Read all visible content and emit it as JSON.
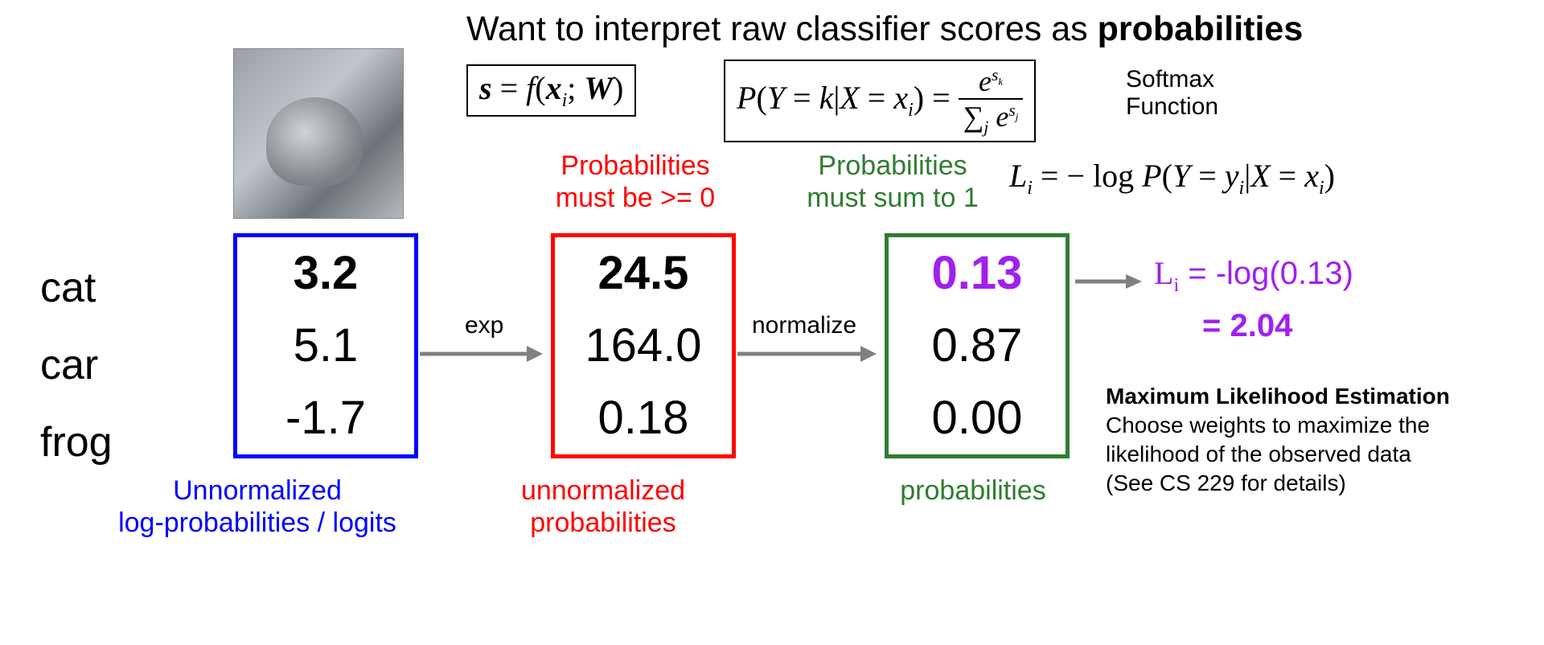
{
  "title": {
    "prefix": "Want to interpret raw classifier scores as ",
    "bold": "probabilities"
  },
  "eq_scores": "s = f(x_i; W)",
  "eq_softmax": "P(Y = k | X = x_i) = e^{s_k} / Σ_j e^{s_j}",
  "softmax_label_1": "Softmax",
  "softmax_label_2": "Function",
  "probs_ge0_line1": "Probabilities",
  "probs_ge0_line2": "must be >= 0",
  "probs_sum1_line1": "Probabilities",
  "probs_sum1_line2": "must sum to 1",
  "eq_loss": "L_i = − log P(Y = y_i | X = x_i)",
  "class_labels": [
    "cat",
    "car",
    "frog"
  ],
  "logits": [
    "3.2",
    "5.1",
    "-1.7"
  ],
  "logits_caption_1": "Unnormalized",
  "logits_caption_2": "log-probabilities / logits",
  "arrow_exp": "exp",
  "unnorm_probs": [
    "24.5",
    "164.0",
    "0.18"
  ],
  "unnorm_caption_1": "unnormalized",
  "unnorm_caption_2": "probabilities",
  "arrow_norm": "normalize",
  "probs": [
    "0.13",
    "0.87",
    "0.00"
  ],
  "probs_caption": "probabilities",
  "loss_expr": "L_i = -log(0.13)",
  "loss_result": "= 2.04",
  "mle_title": "Maximum Likelihood Estimation",
  "mle_line1": "Choose weights to maximize the",
  "mle_line2": "likelihood of the observed data",
  "mle_line3": "(See CS 229 for details)"
}
